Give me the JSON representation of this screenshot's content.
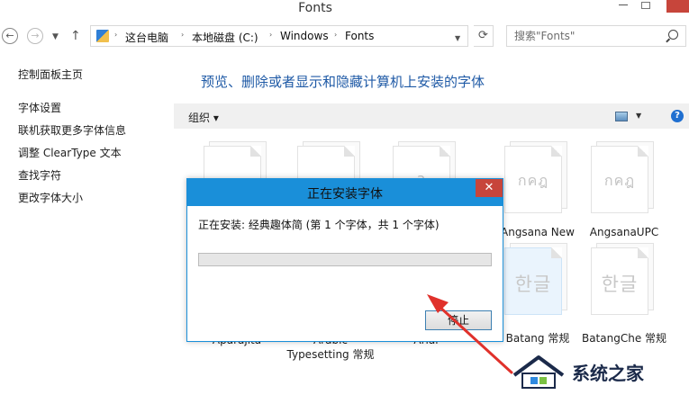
{
  "window": {
    "title": "Fonts"
  },
  "address_bar": {
    "crumbs": [
      "这台电脑",
      "本地磁盘 (C:)",
      "Windows",
      "Fonts"
    ],
    "search_placeholder": "搜索\"Fonts\""
  },
  "left_pane": {
    "home_link": "控制面板主页",
    "links": [
      "字体设置",
      "联机获取更多字体信息",
      "调整 ClearType 文本",
      "查找字符",
      "更改字体大小"
    ]
  },
  "main": {
    "heading": "预览、删除或者显示和隐藏计算机上安装的字体",
    "organize_label": "组织 ▾",
    "help_label": "?"
  },
  "tiles": [
    {
      "glyph": "",
      "name": "Aparajita"
    },
    {
      "glyph": "",
      "name": "Arabic Typesetting 常规"
    },
    {
      "glyph": "a",
      "name": "Arial"
    },
    {
      "glyph": "กคฎ",
      "name": "Angsana New"
    },
    {
      "glyph": "กคฎ",
      "name": "AngsanaUPC"
    },
    {
      "glyph": "한글",
      "name": "Batang 常规"
    },
    {
      "glyph": "한글",
      "name": "BatangChe 常规"
    }
  ],
  "dialog": {
    "title": "正在安装字体",
    "status": "正在安装: 经典趣体简 (第 1 个字体，共 1 个字体)",
    "progress_percent": 0,
    "stop_button": "停止",
    "close_glyph": "✕"
  },
  "watermark": {
    "text": "系统之家"
  },
  "colors": {
    "dialog_accent": "#1a8fd9",
    "heading_blue": "#1f5aa6",
    "close_red": "#c7453b",
    "arrow_red": "#e0312b"
  }
}
